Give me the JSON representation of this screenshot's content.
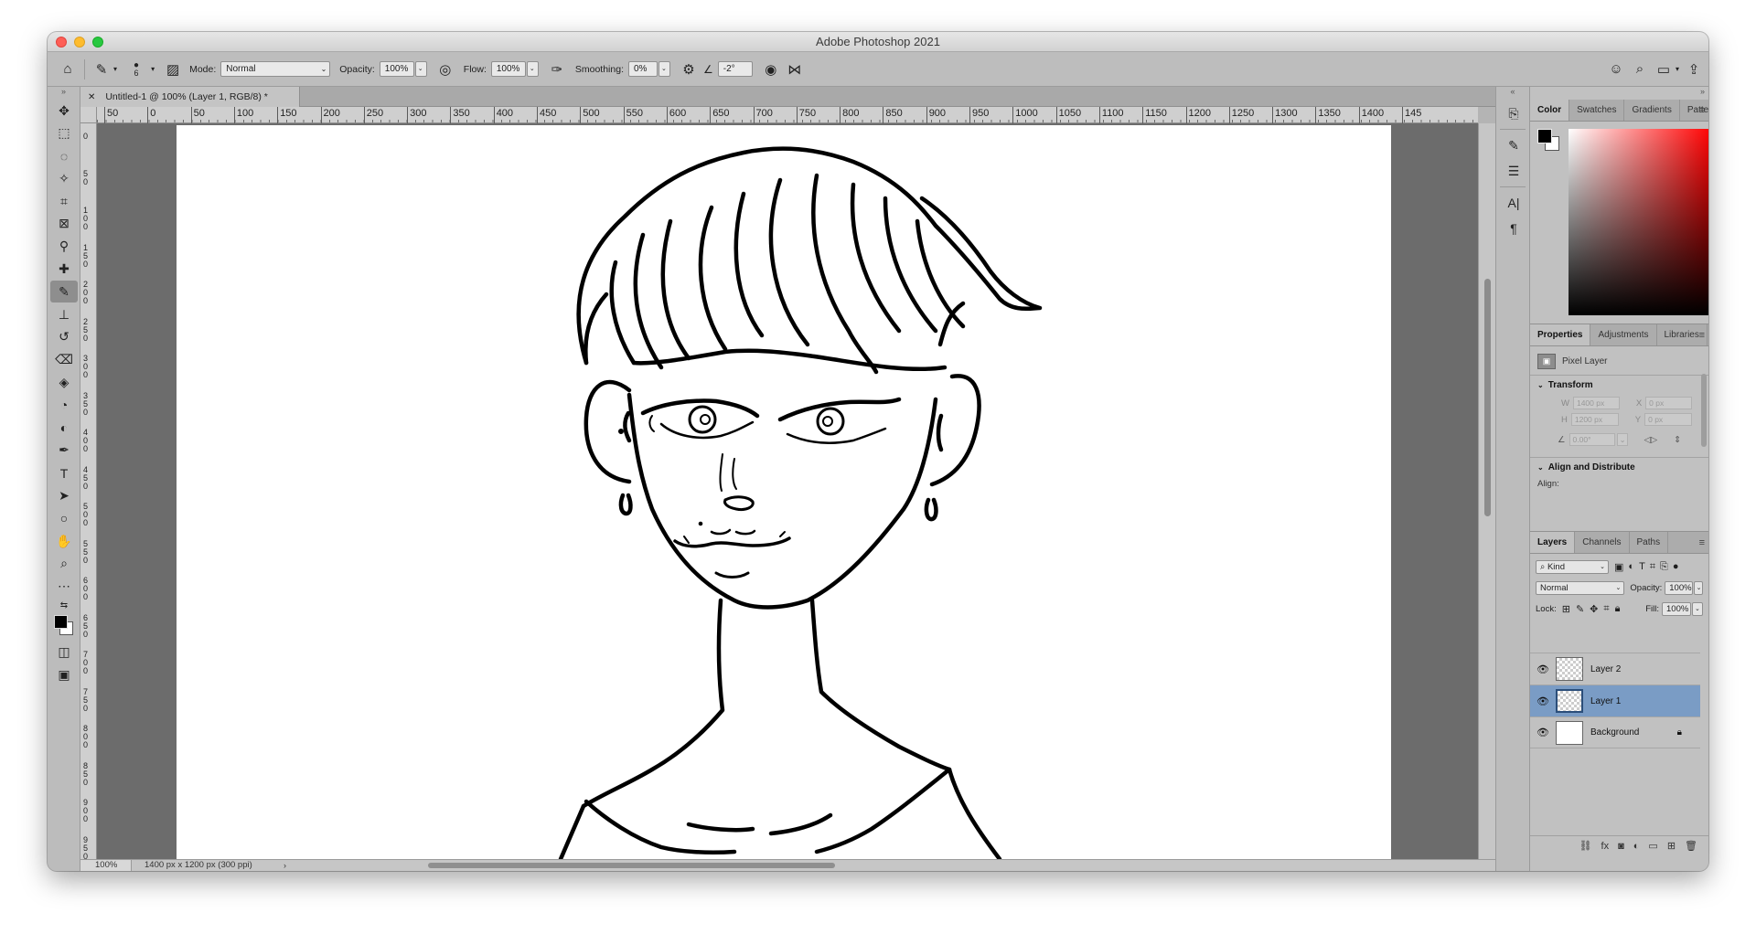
{
  "app": {
    "title": "Adobe Photoshop 2021"
  },
  "options_bar": {
    "brush_size": "6",
    "mode_label": "Mode:",
    "mode_value": "Normal",
    "opacity_label": "Opacity:",
    "opacity_value": "100%",
    "flow_label": "Flow:",
    "flow_value": "100%",
    "smoothing_label": "Smoothing:",
    "smoothing_value": "0%",
    "angle_value": "-2°"
  },
  "document": {
    "tab_title": "Untitled-1 @ 100% (Layer 1, RGB/8) *",
    "zoom": "100%",
    "info": "1400 px x 1200 px (300 ppi)"
  },
  "rulers": {
    "h_labels": [
      "50",
      "0",
      "50",
      "100",
      "150",
      "200",
      "250",
      "300",
      "350",
      "400",
      "450",
      "500",
      "550",
      "600",
      "650",
      "700",
      "750",
      "800",
      "850",
      "900",
      "950",
      "1000",
      "1050",
      "1100",
      "1150",
      "1200",
      "1250",
      "1300",
      "1350",
      "1400",
      "145"
    ],
    "v_labels": [
      "0",
      "50",
      "100",
      "150",
      "200",
      "250",
      "300",
      "350",
      "400",
      "450",
      "500",
      "550",
      "600",
      "650",
      "700",
      "750",
      "800",
      "850",
      "900",
      "950"
    ]
  },
  "color_panel": {
    "tabs": [
      "Color",
      "Swatches",
      "Gradients",
      "Patterns"
    ],
    "foreground": "#000000",
    "background": "#ffffff"
  },
  "properties_panel": {
    "tabs": [
      "Properties",
      "Adjustments",
      "Libraries"
    ],
    "layer_type": "Pixel Layer",
    "transform_title": "Transform",
    "w_label": "W",
    "w_value": "1400 px",
    "h_label": "H",
    "h_value": "1200 px",
    "x_label": "X",
    "x_value": "0 px",
    "y_label": "Y",
    "y_value": "0 px",
    "angle_value": "0.00°",
    "align_title": "Align and Distribute",
    "align_label": "Align:"
  },
  "layers_panel": {
    "tabs": [
      "Layers",
      "Channels",
      "Paths"
    ],
    "filter_value": "Kind",
    "blend_mode": "Normal",
    "opacity_label": "Opacity:",
    "opacity_value": "100%",
    "lock_label": "Lock:",
    "fill_label": "Fill:",
    "fill_value": "100%",
    "layers": [
      {
        "name": "Layer 2",
        "selected": false
      },
      {
        "name": "Layer 1",
        "selected": true
      },
      {
        "name": "Background",
        "selected": false
      }
    ]
  },
  "colors": {
    "selection": "#7a9cc5",
    "ui_bg": "#bcbcbc",
    "pasteboard": "#6c6c6c"
  }
}
